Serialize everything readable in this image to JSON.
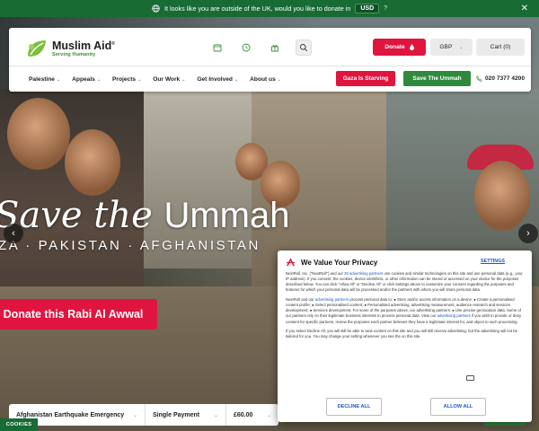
{
  "notice": {
    "text": "It looks like you are outside of the UK, would you like to donate in",
    "currency": "USD",
    "help": "?",
    "close": "✕"
  },
  "brand": {
    "name": "Muslim Aid",
    "registered": "®",
    "tagline": "Serving Humanity",
    "leaf_color": "#7cbf3a"
  },
  "header": {
    "donate_label": "Donate",
    "currency_label": "GBP",
    "cart_label": "Cart",
    "cart_count": "(0)",
    "nav": [
      "Palestine",
      "Appeals",
      "Projects",
      "Our Work",
      "Get Involved",
      "About us"
    ],
    "gaza_label": "Gaza Is Starving",
    "ummah_label": "Save The Ummah",
    "phone": "020 7377 4200"
  },
  "hero": {
    "headline_italic": "Save the",
    "headline_upright": "Ummah",
    "countries": "ZA · PAKISTAN · AFGHANISTAN",
    "cta": "Donate this Rabi Al Awwal"
  },
  "donation_bar": {
    "appeal": "Afghanistan Earthquake Emergency",
    "frequency": "Single Payment",
    "amount": "£60.00"
  },
  "cookies_label": "COOKIES",
  "modal": {
    "title": "We Value Your Privacy",
    "settings": "SETTINGS",
    "para1_a": "NextRoll, Inc. (\"NextRoll\") and our ",
    "para1_link": "20 advertising partners",
    "para1_b": " use cookies and similar technologies on this site and use personal data (e.g., your IP address). If you consent, the cookies, device identifiers, or other information can be stored or accessed on your device for the purposes described below. You can click \"Allow All\" or \"Decline All\" or click Settings above to customize your consent regarding the purposes and features for which your personal data will be processed and/or the partners with whom you will share personal data.",
    "para2_a": "NextRoll and our ",
    "para2_link": "advertising partners",
    "para2_b": " process personal data to: ● Store and/or access information on a device; ● Create a personalised content profile; ● Select personalised content; ● Personalised advertising, advertising measurement, audience research and services development; ● Services development. For some of the purposes above, our advertising partners: ● Use precise geolocation data. Some of our partners rely on their legitimate business interests to process personal data. View our ",
    "para2_link2": "advertising partners",
    "para2_c": " if you wish to provide or deny consent for specific partners, review the purposes each partner believes they have a legitimate interest for, and object to such processing.",
    "para3": "If you select Decline All, you will still be able to view content on this site and you will still receive advertising, but the advertising will not be tailored for you. You may change your setting whenever you see the",
    "para3_end": " on this site.",
    "decline": "DECLINE ALL",
    "allow": "ALLOW ALL",
    "accent": "#1d55c4"
  },
  "colors": {
    "notice_green": "#176b33",
    "donate_red": "#e0153f",
    "button_green": "#2f8a3e"
  }
}
